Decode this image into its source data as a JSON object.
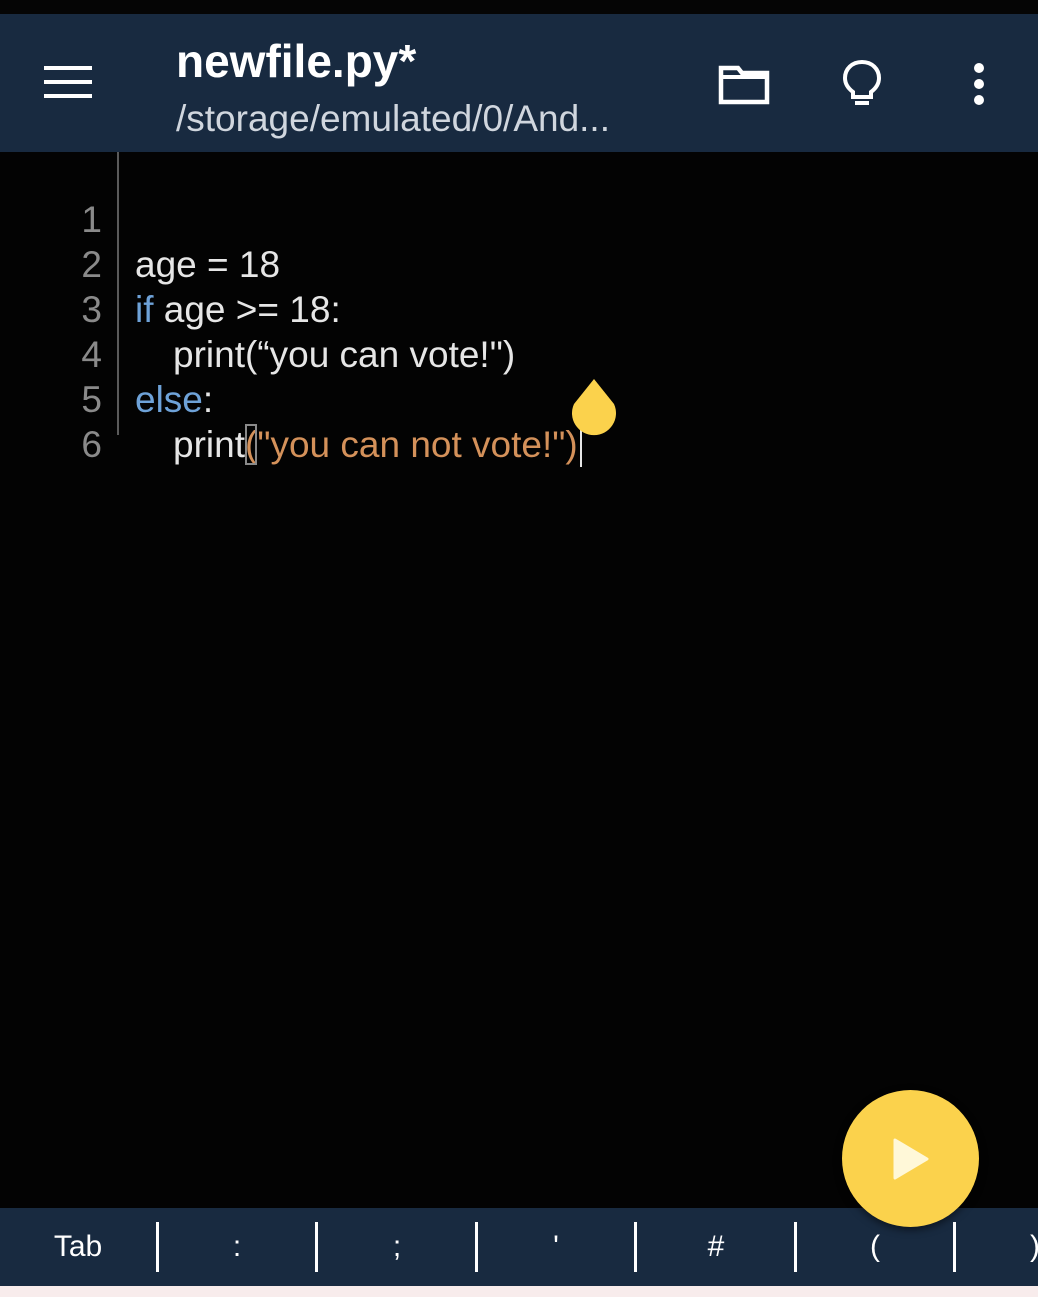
{
  "app_bar": {
    "title": "newfile.py*",
    "path": "/storage/emulated/0/And...",
    "icons": [
      "hamburger-menu-icon",
      "folder-icon",
      "lightbulb-icon",
      "more-vert-icon"
    ]
  },
  "editor": {
    "lines": [
      {
        "num": "1",
        "tokens": {
          "a": "age = 18"
        }
      },
      {
        "num": "2",
        "tokens": {
          "kw": "if",
          "rest": " age >= 18:"
        }
      },
      {
        "num": "3",
        "tokens": {
          "text": "print(“you can vote!\")"
        }
      },
      {
        "num": "4",
        "tokens": {
          "kw": "else",
          "rest": ":"
        }
      },
      {
        "num": "5",
        "tokens": {
          "fn": "print",
          "paren": "(",
          "str": "\"you can not vote!\")"
        }
      },
      {
        "num": "6"
      }
    ]
  },
  "run_button": {
    "icon": "play-icon"
  },
  "symbol_bar": {
    "keys": [
      "Tab",
      ":",
      ";",
      "'",
      "#",
      "(",
      ")"
    ]
  },
  "colors": {
    "app_bar_bg": "#182a40",
    "editor_bg": "#030303",
    "keyword": "#6ea2d8",
    "string": "#d4915a",
    "fab": "#fbd24c"
  }
}
